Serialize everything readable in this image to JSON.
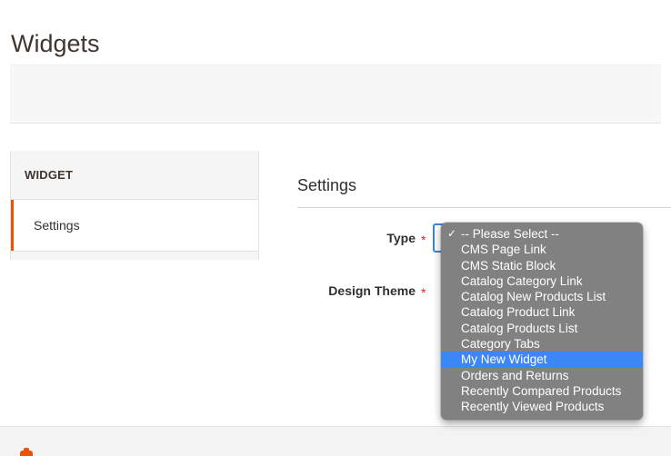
{
  "page": {
    "title": "Widgets"
  },
  "sidebar": {
    "header_label": "WIDGET",
    "items": [
      {
        "label": "Settings"
      }
    ]
  },
  "main": {
    "section_title": "Settings",
    "fields": [
      {
        "label": "Type",
        "required_marker": "*"
      },
      {
        "label": "Design Theme",
        "required_marker": "*"
      }
    ]
  },
  "dropdown": {
    "selected_label": "My New Widget",
    "checked_label": "-- Please Select --",
    "check_glyph": "✓",
    "highlight_color": "#3b87f7",
    "background_color": "#818181",
    "items": [
      {
        "label": "-- Please Select --",
        "checked": true,
        "highlighted": false
      },
      {
        "label": "CMS Page Link",
        "checked": false,
        "highlighted": false
      },
      {
        "label": "CMS Static Block",
        "checked": false,
        "highlighted": false
      },
      {
        "label": "Catalog Category Link",
        "checked": false,
        "highlighted": false
      },
      {
        "label": "Catalog New Products List",
        "checked": false,
        "highlighted": false
      },
      {
        "label": "Catalog Product Link",
        "checked": false,
        "highlighted": false
      },
      {
        "label": "Catalog Products List",
        "checked": false,
        "highlighted": false
      },
      {
        "label": "Category Tabs",
        "checked": false,
        "highlighted": false
      },
      {
        "label": "My New Widget",
        "checked": false,
        "highlighted": true
      },
      {
        "label": "Orders and Returns",
        "checked": false,
        "highlighted": false
      },
      {
        "label": "Recently Compared Products",
        "checked": false,
        "highlighted": false
      },
      {
        "label": "Recently Viewed Products",
        "checked": false,
        "highlighted": false
      }
    ]
  },
  "theme": {
    "accent_orange": "#eb5202",
    "required_red": "#e22626",
    "focus_blue": "#3a86d6"
  }
}
